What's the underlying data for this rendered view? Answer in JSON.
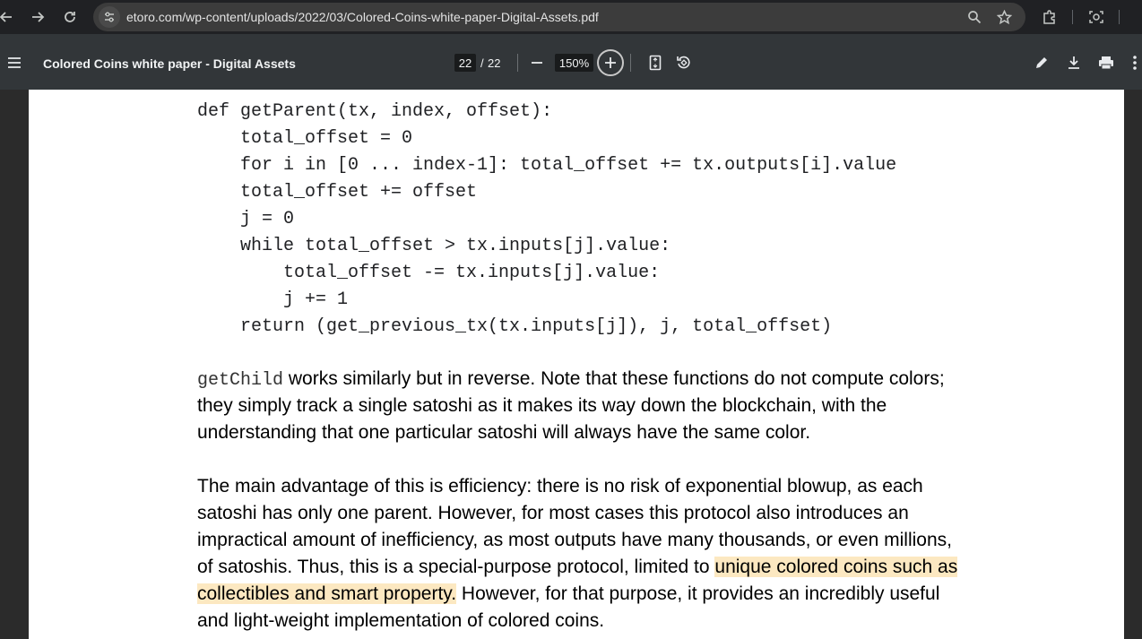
{
  "browser": {
    "url": "etoro.com/wp-content/uploads/2022/03/Colored-Coins-white-paper-Digital-Assets.pdf"
  },
  "pdf_toolbar": {
    "title": "Colored Coins white paper - Digital Assets",
    "current_page": "22",
    "page_separator": "/",
    "total_pages": "22",
    "zoom": "150%"
  },
  "document": {
    "code_lines": [
      "def getParent(tx, index, offset):",
      "    total_offset = 0",
      "    for i in [0 ... index-1]: total_offset += tx.outputs[i].value",
      "    total_offset += offset",
      "    j = 0",
      "    while total_offset > tx.inputs[j].value:",
      "        total_offset -= tx.inputs[j].value:",
      "        j += 1",
      "    return (get_previous_tx(tx.inputs[j]), j, total_offset)"
    ],
    "para1": {
      "code_word": "getChild",
      "line1_rest": " works similarly but in reverse. Note that these functions do not compute colors;",
      "line2": "they simply track a single satoshi as it makes its way down the blockchain, with the",
      "line3": "understanding that one particular satoshi will always have the same color."
    },
    "para2": {
      "line1": "The main advantage of this is efficiency: there is no risk of exponential blowup, as each",
      "line2": "satoshi has only one parent. However, for most cases this protocol also introduces an",
      "line3": "impractical amount of inefficiency, as most outputs have many thousands, or even millions,",
      "line4_plain": "of satoshis. Thus, this is a special-purpose protocol, limited to ",
      "line4_highlight": "unique colored coins such as",
      "line5_highlight": "collectibles and smart property.",
      "line5_plain": " However, for that purpose, it provides an incredibly useful",
      "line6": "and light-weight implementation of colored coins."
    }
  },
  "colors": {
    "highlight": "#fce8c1",
    "toolbar": "#323639",
    "browser_bar": "#202124"
  }
}
